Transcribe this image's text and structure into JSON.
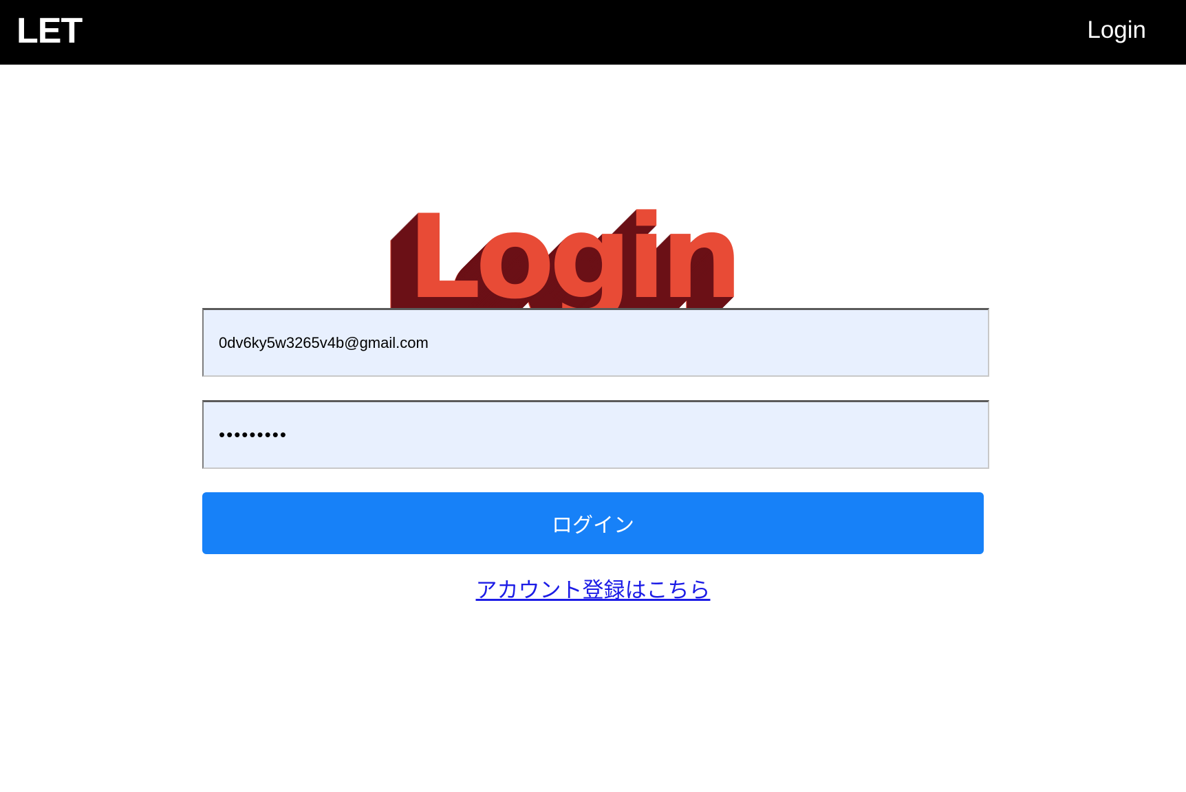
{
  "header": {
    "brand": "LET",
    "nav_login": "Login"
  },
  "hero": {
    "title": "Login",
    "front_color": "#e84b36",
    "shadow_color": "#6b1016"
  },
  "form": {
    "email_value": "0dv6ky5w3265v4b@gmail.com",
    "password_value": "•••••••••",
    "submit_label": "ログイン",
    "field_background": "#e8f0fe",
    "button_color": "#1781f8"
  },
  "footer_link": {
    "register_label": "アカウント登録はこちら"
  }
}
